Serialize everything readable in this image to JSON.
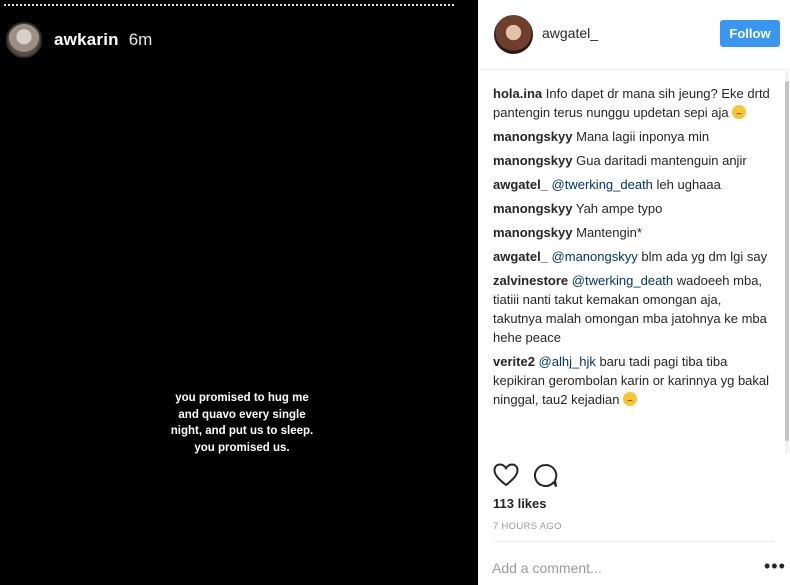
{
  "story": {
    "username": "awkarin",
    "time": "6m",
    "caption": "you promised to hug me\nand quavo every single\nnight, and put us to sleep.\nyou promised us."
  },
  "post": {
    "username": "awgatel_",
    "follow_label": "Follow",
    "comments": [
      {
        "user": "hola.ina",
        "parts": [
          {
            "t": "Info dapet dr mana sih jeung? Eke drtd pantengin terus nunggu updetan sepi aja "
          }
        ],
        "emoji": "sad-face"
      },
      {
        "user": "manongskyy",
        "parts": [
          {
            "t": "Mana lagii inponya min"
          }
        ]
      },
      {
        "user": "manongskyy",
        "parts": [
          {
            "t": "Gua daritadi mantenguin anjir"
          }
        ]
      },
      {
        "user": "awgatel_",
        "parts": [
          {
            "m": "@twerking_death"
          },
          {
            "t": " leh ughaaa"
          }
        ]
      },
      {
        "user": "manongskyy",
        "parts": [
          {
            "t": "Yah ampe typo"
          }
        ]
      },
      {
        "user": "manongskyy",
        "parts": [
          {
            "t": "Mantengin*"
          }
        ]
      },
      {
        "user": "awgatel_",
        "parts": [
          {
            "m": "@manongskyy"
          },
          {
            "t": " blm ada yg dm lgi say"
          }
        ]
      },
      {
        "user": "zalvinestore",
        "parts": [
          {
            "m": "@twerking_death"
          },
          {
            "t": " wadoeeh mba, tiatiii nanti takut kemakan omongan aja, takutnya malah omongan mba jatohnya ke mba hehe peace"
          }
        ]
      },
      {
        "user": "verite2",
        "parts": [
          {
            "m": "@alhj_hjk"
          },
          {
            "t": " baru tadi pagi tiba tiba kepikiran gerombolan karin or karinnya yg bakal ninggal, tau2 kejadian "
          }
        ],
        "emoji": "worried-face"
      }
    ],
    "likes": "113 likes",
    "time_ago": "7 HOURS AGO",
    "add_comment_placeholder": "Add a comment...",
    "more_label": "•••"
  }
}
